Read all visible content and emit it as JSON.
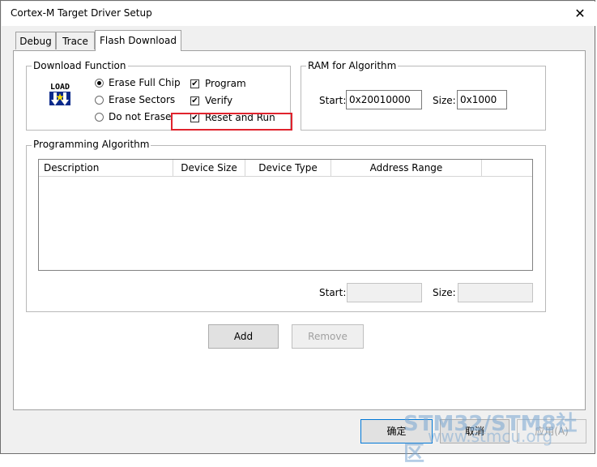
{
  "window": {
    "title": "Cortex-M Target Driver Setup"
  },
  "tabs": [
    {
      "label": "Debug"
    },
    {
      "label": "Trace"
    },
    {
      "label": "Flash Download"
    }
  ],
  "download_function": {
    "title": "Download Function",
    "icon_text": "LOAD",
    "radios": [
      {
        "label": "Erase Full Chip",
        "checked": true
      },
      {
        "label": "Erase Sectors",
        "checked": false
      },
      {
        "label": "Do not Erase",
        "checked": false
      }
    ],
    "checks": [
      {
        "label": "Program",
        "checked": true
      },
      {
        "label": "Verify",
        "checked": true
      },
      {
        "label": "Reset and Run",
        "checked": true
      }
    ]
  },
  "ram": {
    "title": "RAM for Algorithm",
    "start_label": "Start:",
    "start_value": "0x20010000",
    "size_label": "Size:",
    "size_value": "0x1000"
  },
  "programming_algorithm": {
    "title": "Programming Algorithm",
    "columns": [
      "Description",
      "Device Size",
      "Device Type",
      "Address Range"
    ],
    "start_label": "Start:",
    "start_value": "",
    "size_label": "Size:",
    "size_value": ""
  },
  "buttons": {
    "add": "Add",
    "remove": "Remove",
    "ok": "确定",
    "cancel": "取消",
    "apply": "应用(A)"
  },
  "watermark": {
    "brand": "STM32/STM8社区",
    "url": "www.stmcu.org"
  },
  "colors": {
    "highlight_box": "#e0232d",
    "dialog_bg": "#f0f0f0",
    "panel_bg": "#ffffff"
  }
}
